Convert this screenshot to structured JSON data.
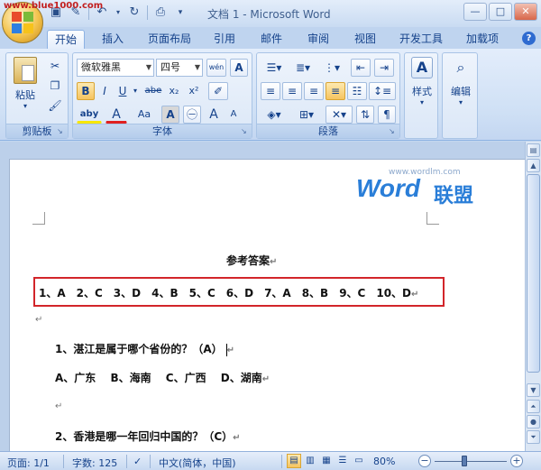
{
  "window": {
    "title": "文档 1 - Microsoft Word",
    "watermark": "www.blue1000.com",
    "controls": {
      "minimize": "—",
      "maximize": "□",
      "close": "✕"
    }
  },
  "quick_access": {
    "icons": [
      "save-icon",
      "format-painter-icon",
      "undo-icon",
      "redo-icon",
      "print-preview-icon",
      "customize-dropdown-icon"
    ]
  },
  "tabs": [
    {
      "label": "开始",
      "active": true
    },
    {
      "label": "插入"
    },
    {
      "label": "页面布局"
    },
    {
      "label": "引用"
    },
    {
      "label": "邮件"
    },
    {
      "label": "审阅"
    },
    {
      "label": "视图"
    },
    {
      "label": "开发工具"
    },
    {
      "label": "加载项"
    }
  ],
  "help": "?",
  "ribbon": {
    "clipboard": {
      "label": "剪贴板",
      "paste_label": "粘贴"
    },
    "font": {
      "label": "字体",
      "font_name": "微软雅黑",
      "font_size": "四号",
      "bold": "B",
      "italic": "I",
      "underline": "U",
      "strike": "abe",
      "subscript": "x₂",
      "superscript": "x²",
      "case": "Aa",
      "char_shade": "A",
      "grow": "A",
      "shrink": "A",
      "font_color": "A",
      "highlight": "aby"
    },
    "paragraph": {
      "label": "段落"
    },
    "styles": {
      "label": "样式"
    },
    "editing": {
      "label": "编辑"
    }
  },
  "brand": {
    "site": "www.wordlm.com",
    "word": "Word",
    "name": "联盟"
  },
  "document": {
    "title": "参考答案",
    "answers": "1、A　2、C　3、D　4、B　5、C　6、D　7、A　8、B　9、C　10、D",
    "q1": "1、湛江是属于哪个省份的？（A）",
    "q1_options": "A、广东　 B、海南　 C、广西　 D、湖南",
    "q2": "2、香港是哪一年回归中国的？（C）",
    "mark": "↵"
  },
  "status": {
    "page": "页面: 1/1",
    "words": "字数: 125",
    "language": "中文(简体，中国)",
    "zoom": "80%"
  }
}
